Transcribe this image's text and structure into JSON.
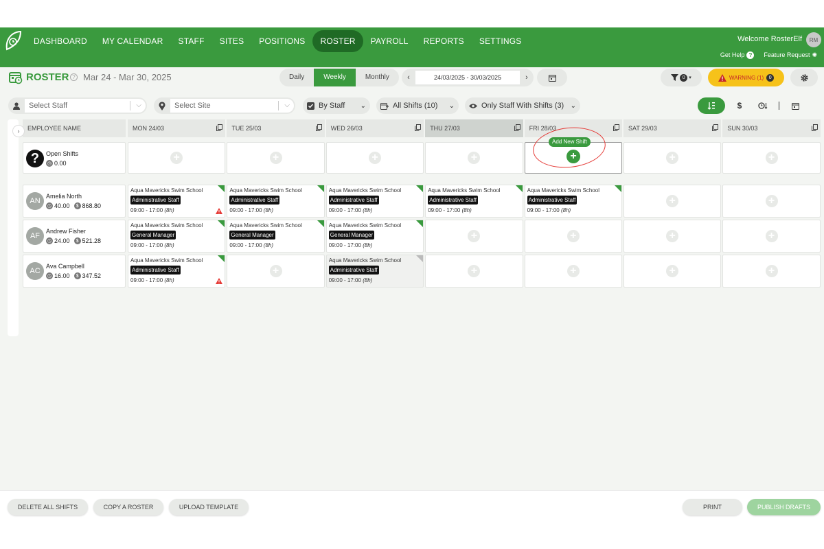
{
  "nav": {
    "items": [
      {
        "label": "DASHBOARD",
        "active": false
      },
      {
        "label": "MY CALENDAR",
        "active": false
      },
      {
        "label": "STAFF",
        "active": false
      },
      {
        "label": "SITES",
        "active": false
      },
      {
        "label": "POSITIONS",
        "active": false
      },
      {
        "label": "ROSTER",
        "active": true
      },
      {
        "label": "PAYROLL",
        "active": false
      },
      {
        "label": "REPORTS",
        "active": false
      },
      {
        "label": "SETTINGS",
        "active": false
      }
    ],
    "welcome": "Welcome RosterElf",
    "user_initials": "RM",
    "get_help": "Get Help",
    "feature_request": "Feature Request"
  },
  "header": {
    "title": "ROSTER",
    "date_range": "Mar 24 - Mar 30, 2025",
    "views": [
      "Daily",
      "Weekly",
      "Monthly"
    ],
    "active_view": "Weekly",
    "date_value": "24/03/2025 - 30/03/2025",
    "filter_count": "0",
    "warning_label": "WARNING (1)",
    "warning_count": "0"
  },
  "filters": {
    "staff_placeholder": "Select Staff",
    "site_placeholder": "Select Site",
    "group_by": "By Staff",
    "shifts": "All Shifts (10)",
    "visibility": "Only Staff With Shifts (3)"
  },
  "grid": {
    "employee_header": "EMPLOYEE NAME",
    "days": [
      "MON 24/03",
      "TUE 25/03",
      "WED 26/03",
      "THU 27/03",
      "FRI 28/03",
      "SAT 29/03",
      "SUN 30/03"
    ],
    "open_shifts": {
      "name": "Open Shifts",
      "hours": "0.00"
    },
    "add_new_shift": "Add New Shift",
    "employees": [
      {
        "initials": "AN",
        "name": "Amelia North",
        "hours": "40.00",
        "cost": "868.80",
        "shifts": [
          {
            "site": "Aqua Mavericks Swim School",
            "role": "Administrative Staff",
            "time": "09:00 - 17:00",
            "dur": "(8h)",
            "warning": true
          },
          {
            "site": "Aqua Mavericks Swim School",
            "role": "Administrative Staff",
            "time": "09:00 - 17:00",
            "dur": "(8h)",
            "warning": false
          },
          {
            "site": "Aqua Mavericks Swim School",
            "role": "Administrative Staff",
            "time": "09:00 - 17:00",
            "dur": "(8h)",
            "warning": false
          },
          {
            "site": "Aqua Mavericks Swim School",
            "role": "Administrative Staff",
            "time": "09:00 - 17:00",
            "dur": "(8h)",
            "warning": false
          },
          {
            "site": "Aqua Mavericks Swim School",
            "role": "Administrative Staff",
            "time": "09:00 - 17:00",
            "dur": "(8h)",
            "warning": false
          },
          null,
          null
        ]
      },
      {
        "initials": "AF",
        "name": "Andrew Fisher",
        "hours": "24.00",
        "cost": "521.28",
        "shifts": [
          {
            "site": "Aqua Mavericks Swim School",
            "role": "General Manager",
            "time": "09:00 - 17:00",
            "dur": "(8h)",
            "warning": false
          },
          {
            "site": "Aqua Mavericks Swim School",
            "role": "General Manager",
            "time": "09:00 - 17:00",
            "dur": "(8h)",
            "warning": false
          },
          {
            "site": "Aqua Mavericks Swim School",
            "role": "General Manager",
            "time": "09:00 - 17:00",
            "dur": "(8h)",
            "warning": false
          },
          null,
          null,
          null,
          null
        ]
      },
      {
        "initials": "AC",
        "name": "Ava Campbell",
        "hours": "16.00",
        "cost": "347.52",
        "shifts": [
          {
            "site": "Aqua Mavericks Swim School",
            "role": "Administrative Staff",
            "time": "09:00 - 17:00",
            "dur": "(8h)",
            "warning": true
          },
          null,
          {
            "site": "Aqua Mavericks Swim School",
            "role": "Administrative Staff",
            "time": "09:00 - 17:00",
            "dur": "(8h)",
            "warning": false,
            "draft": true
          },
          null,
          null,
          null,
          null
        ]
      }
    ]
  },
  "footer": {
    "delete_all": "DELETE ALL SHIFTS",
    "copy_roster": "COPY A ROSTER",
    "upload_template": "UPLOAD TEMPLATE",
    "print": "PRINT",
    "publish": "PUBLISH DRAFTS"
  },
  "colors": {
    "brand": "#3a9a3e",
    "nav_active": "#1f6a25",
    "warning": "#f6c21a",
    "danger": "#e53935"
  }
}
